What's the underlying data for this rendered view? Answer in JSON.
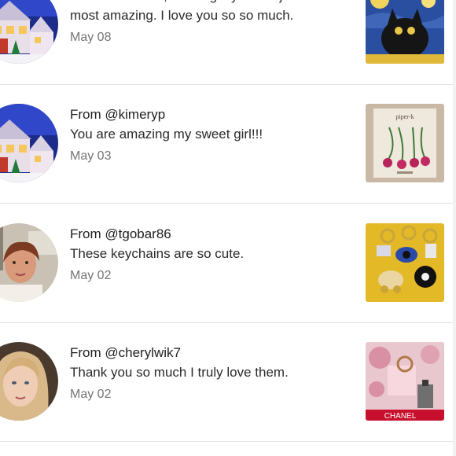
{
  "feedback": [
    {
      "from": "",
      "message": "Love it so much, sweet girl you are just the most amazing. I love you so so much.",
      "date": "May 08",
      "avatar_icon": "christmas-village-avatar-icon",
      "thumb_icon": "black-cat-painting-thumbnail"
    },
    {
      "from": "From @kimeryp",
      "message": "You are amazing my sweet girl!!!",
      "date": "May 03",
      "avatar_icon": "christmas-village-avatar-icon",
      "thumb_icon": "cherry-earrings-thumbnail",
      "thumb_label": "piper-k"
    },
    {
      "from": "From @tgobar86",
      "message": "These keychains are so cute.",
      "date": "May 02",
      "avatar_icon": "user-photo-avatar-icon",
      "thumb_icon": "keychains-thumbnail"
    },
    {
      "from": "From @cherylwik7",
      "message": "Thank you so much I truly love them.",
      "date": "May 02",
      "avatar_icon": "user-photo-avatar-icon",
      "thumb_icon": "chanel-items-thumbnail",
      "thumb_label": "CHANEL"
    }
  ],
  "colors": {
    "date_text": "#757575",
    "divider": "#e3e3e3"
  }
}
